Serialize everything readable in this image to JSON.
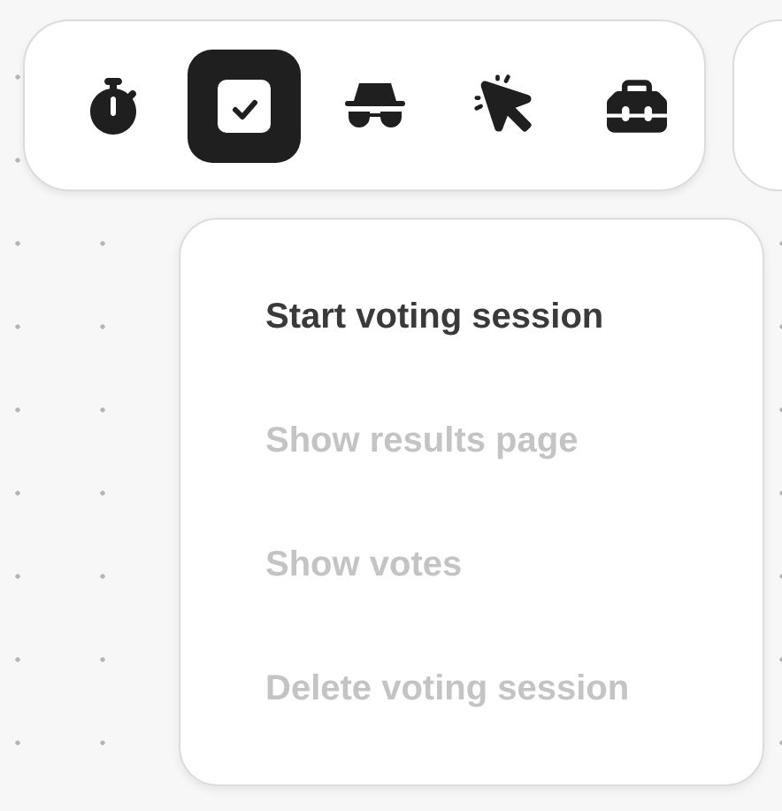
{
  "toolbar": {
    "tools": [
      {
        "kind": "timer",
        "selected": false
      },
      {
        "kind": "voting",
        "selected": true
      },
      {
        "kind": "incognito",
        "selected": false
      },
      {
        "kind": "click",
        "selected": false
      },
      {
        "kind": "toolbox",
        "selected": false
      }
    ]
  },
  "menu": {
    "items": [
      {
        "label": "Start voting session",
        "disabled": false
      },
      {
        "label": "Show results page",
        "disabled": true
      },
      {
        "label": "Show votes",
        "disabled": true
      },
      {
        "label": "Delete voting session",
        "disabled": true
      }
    ]
  }
}
